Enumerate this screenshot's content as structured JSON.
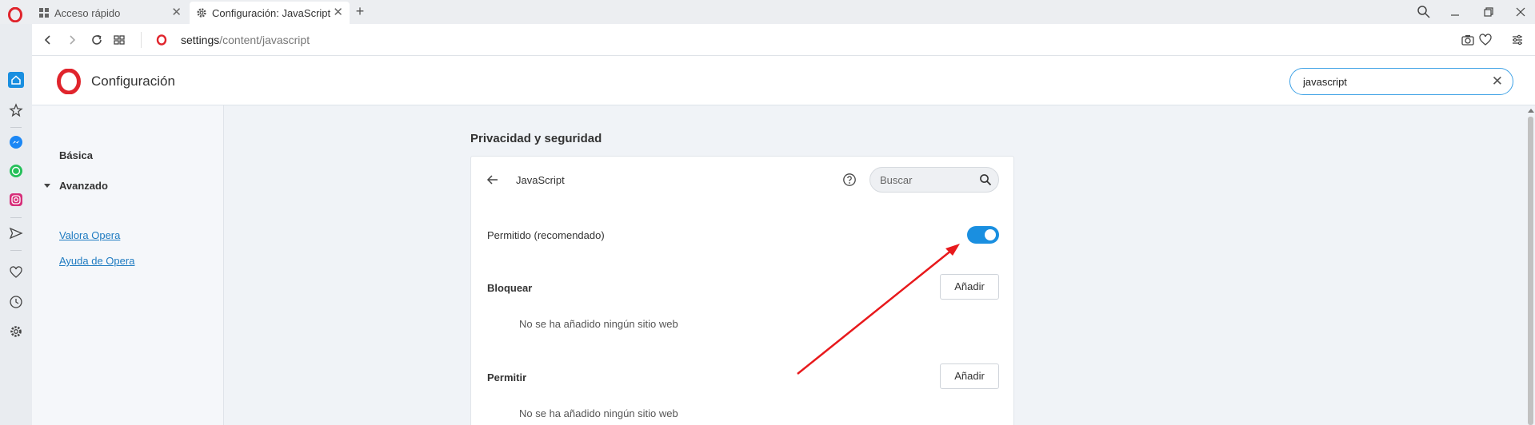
{
  "browser": {
    "tabs": [
      {
        "label": "Acceso rápido",
        "icon": "grid-icon",
        "active": false
      },
      {
        "label": "Configuración: JavaScript",
        "icon": "gear-icon",
        "active": true
      }
    ],
    "new_tab": "+",
    "url": {
      "host": "settings",
      "path": "/content/javascript"
    }
  },
  "settings": {
    "title": "Configuración",
    "search": {
      "value": "javascript"
    },
    "nav": {
      "items": [
        "Básica",
        "Avanzado"
      ],
      "links": [
        "Valora Opera",
        "Ayuda de Opera"
      ]
    },
    "section_title": "Privacidad y seguridad",
    "card": {
      "title": "JavaScript",
      "search_placeholder": "Buscar",
      "allowed_label": "Permitido (recomendado)",
      "allowed_on": true,
      "block": {
        "label": "Bloquear",
        "add": "Añadir",
        "empty": "No se ha añadido ningún sitio web"
      },
      "allow": {
        "label": "Permitir",
        "add": "Añadir",
        "empty": "No se ha añadido ningún sitio web"
      }
    }
  },
  "colors": {
    "accent": "#1a8fe0",
    "opera_red": "#e0242c",
    "annotation": "#e8191c"
  }
}
